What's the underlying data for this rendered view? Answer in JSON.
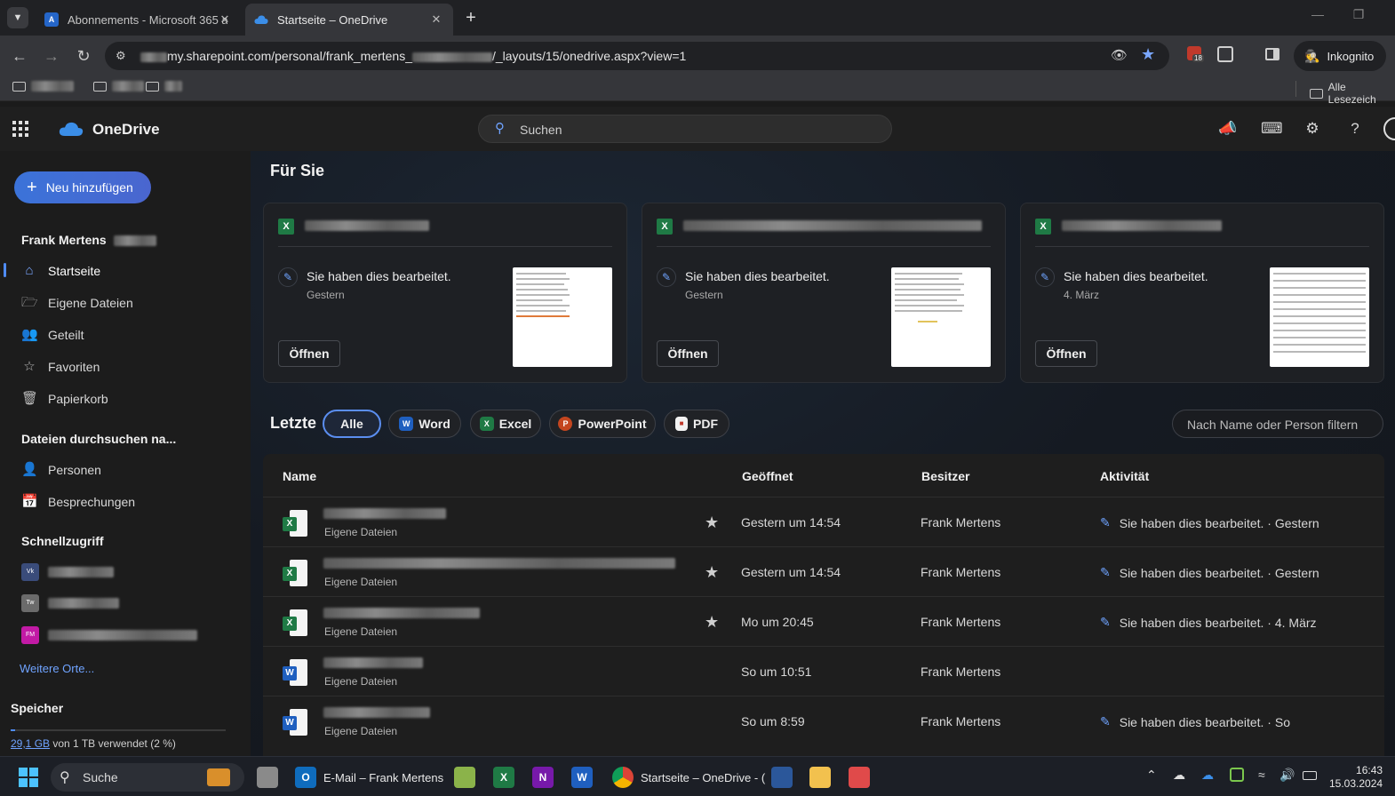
{
  "browser": {
    "tabs": [
      {
        "title": "Abonnements - Microsoft 365 a",
        "active": false
      },
      {
        "title": "Startseite – OneDrive",
        "active": true
      }
    ],
    "url": "my.sharepoint.com/personal/frank_mertens_",
    "url_suffix": "/_layouts/15/onedrive.aspx?view=1",
    "incognito_label": "Inkognito",
    "extension_badge": "18",
    "all_bookmarks_label": "Alle Lesezeich"
  },
  "app": {
    "brand": "OneDrive",
    "search_placeholder": "Suchen"
  },
  "leftnav": {
    "new_button": "Neu hinzufügen",
    "user_name": "Frank Mertens",
    "items": [
      {
        "label": "Startseite",
        "icon": "home-icon",
        "active": true
      },
      {
        "label": "Eigene Dateien",
        "icon": "folder-icon"
      },
      {
        "label": "Geteilt",
        "icon": "people-icon"
      },
      {
        "label": "Favoriten",
        "icon": "star-icon"
      },
      {
        "label": "Papierkorb",
        "icon": "trash-icon"
      }
    ],
    "browse_heading": "Dateien durchsuchen na...",
    "browse_items": [
      {
        "label": "Personen",
        "icon": "person-icon"
      },
      {
        "label": "Besprechungen",
        "icon": "calendar-icon"
      }
    ],
    "quick_heading": "Schnellzugriff",
    "quick_items": [
      {
        "badge": "Vk",
        "color": "#3a4c7a"
      },
      {
        "badge": "Tw",
        "color": "#6b6b6b"
      },
      {
        "badge": "FM",
        "color": "#c21aa5"
      }
    ],
    "more_places": "Weitere Orte...",
    "storage_heading": "Speicher",
    "storage_used": "29,1 GB",
    "storage_rest": " von 1 TB verwendet (2 %)",
    "storage_fraction": 0.02
  },
  "main": {
    "for_you_heading": "Für Sie",
    "cards": [
      {
        "edited": "Sie haben dies bearbeitet.",
        "when": "Gestern",
        "open": "Öffnen"
      },
      {
        "edited": "Sie haben dies bearbeitet.",
        "when": "Gestern",
        "open": "Öffnen"
      },
      {
        "edited": "Sie haben dies bearbeitet.",
        "when": "4. März",
        "open": "Öffnen"
      }
    ],
    "recent_heading": "Letzte",
    "filters": [
      "Alle",
      "Word",
      "Excel",
      "PowerPoint",
      "PDF"
    ],
    "filter_placeholder": "Nach Name oder Person filtern",
    "columns": [
      "Name",
      "Geöffnet",
      "Besitzer",
      "Aktivität"
    ],
    "rows": [
      {
        "type": "excel",
        "location": "Eigene Dateien",
        "favorite": true,
        "opened": "Gestern um 14:54",
        "owner": "Frank Mertens",
        "activity": "Sie haben dies bearbeitet. · Gestern"
      },
      {
        "type": "excel",
        "location": "Eigene Dateien",
        "favorite": true,
        "opened": "Gestern um 14:54",
        "owner": "Frank Mertens",
        "activity": "Sie haben dies bearbeitet. · Gestern"
      },
      {
        "type": "excel",
        "location": "Eigene Dateien",
        "favorite": true,
        "opened": "Mo um 20:45",
        "owner": "Frank Mertens",
        "activity": "Sie haben dies bearbeitet. · 4. März"
      },
      {
        "type": "word",
        "location": "Eigene Dateien",
        "favorite": false,
        "opened": "So um 10:51",
        "owner": "Frank Mertens",
        "activity": ""
      },
      {
        "type": "word",
        "location": "Eigene Dateien",
        "favorite": false,
        "opened": "So um 8:59",
        "owner": "Frank Mertens",
        "activity": "Sie haben dies bearbeitet. · So"
      }
    ]
  },
  "taskbar": {
    "search": "Suche",
    "mail_app": "E-Mail – Frank Mertens",
    "chrome_app": "Startseite – OneDrive - (",
    "time": "16:43",
    "date": "15.03.2024"
  }
}
